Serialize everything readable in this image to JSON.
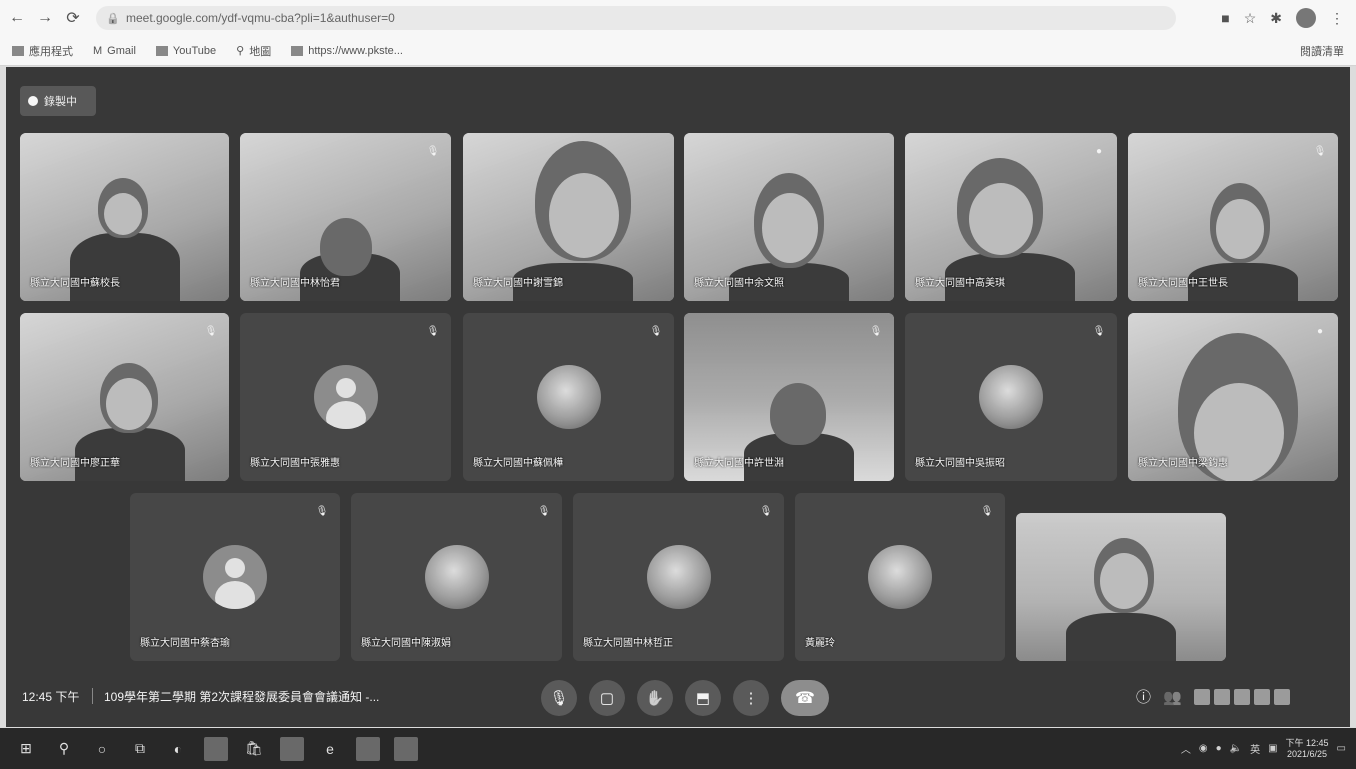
{
  "browser": {
    "url": "meet.google.com/ydf-vqmu-cba?pli=1&authuser=0",
    "bookmarks": [
      "應用程式",
      "Gmail",
      "YouTube",
      "地圖",
      "https://www.pkste..."
    ],
    "reading_list": "閱讀清單"
  },
  "meet": {
    "recording_label": "錄製中",
    "participants": [
      {
        "name": "縣立大同國中蘇校長",
        "video": true,
        "muted": false
      },
      {
        "name": "縣立大同國中林怡君",
        "video": true,
        "muted": true
      },
      {
        "name": "縣立大同國中謝雪錦",
        "video": true,
        "muted": false
      },
      {
        "name": "縣立大同國中余文照",
        "video": true,
        "muted": false
      },
      {
        "name": "縣立大同國中高美琪",
        "video": true,
        "muted": false
      },
      {
        "name": "縣立大同國中王世長",
        "video": true,
        "muted": true
      },
      {
        "name": "縣立大同國中廖正華",
        "video": true,
        "muted": true
      },
      {
        "name": "縣立大同國中張雅惠",
        "video": false,
        "muted": true
      },
      {
        "name": "縣立大同國中蘇佩樺",
        "video": false,
        "muted": true
      },
      {
        "name": "縣立大同國中許世淵",
        "video": true,
        "muted": true
      },
      {
        "name": "縣立大同國中吳振昭",
        "video": false,
        "muted": true
      },
      {
        "name": "縣立大同國中梁鈞惠",
        "video": true,
        "muted": false
      },
      {
        "name": "縣立大同國中蔡杏瑜",
        "video": false,
        "muted": true
      },
      {
        "name": "縣立大同國中陳淑娟",
        "video": false,
        "muted": true
      },
      {
        "name": "縣立大同國中林哲正",
        "video": false,
        "muted": true
      },
      {
        "name": "黃麗玲",
        "video": false,
        "muted": true
      },
      {
        "name": "",
        "video": true,
        "muted": false
      }
    ],
    "time": "12:45 下午",
    "meeting_title": "109學年第二學期 第2次課程發展委員會會議通知 -...",
    "icons": {
      "mic": "microphone-icon",
      "camera": "camera-icon",
      "hand": "raise-hand-icon",
      "present": "present-screen-icon",
      "more": "more-options-icon",
      "end": "end-call-icon",
      "info": "info-icon",
      "people": "people-icon"
    }
  },
  "taskbar": {
    "time": "下午 12:45",
    "date": "2021/6/25"
  }
}
